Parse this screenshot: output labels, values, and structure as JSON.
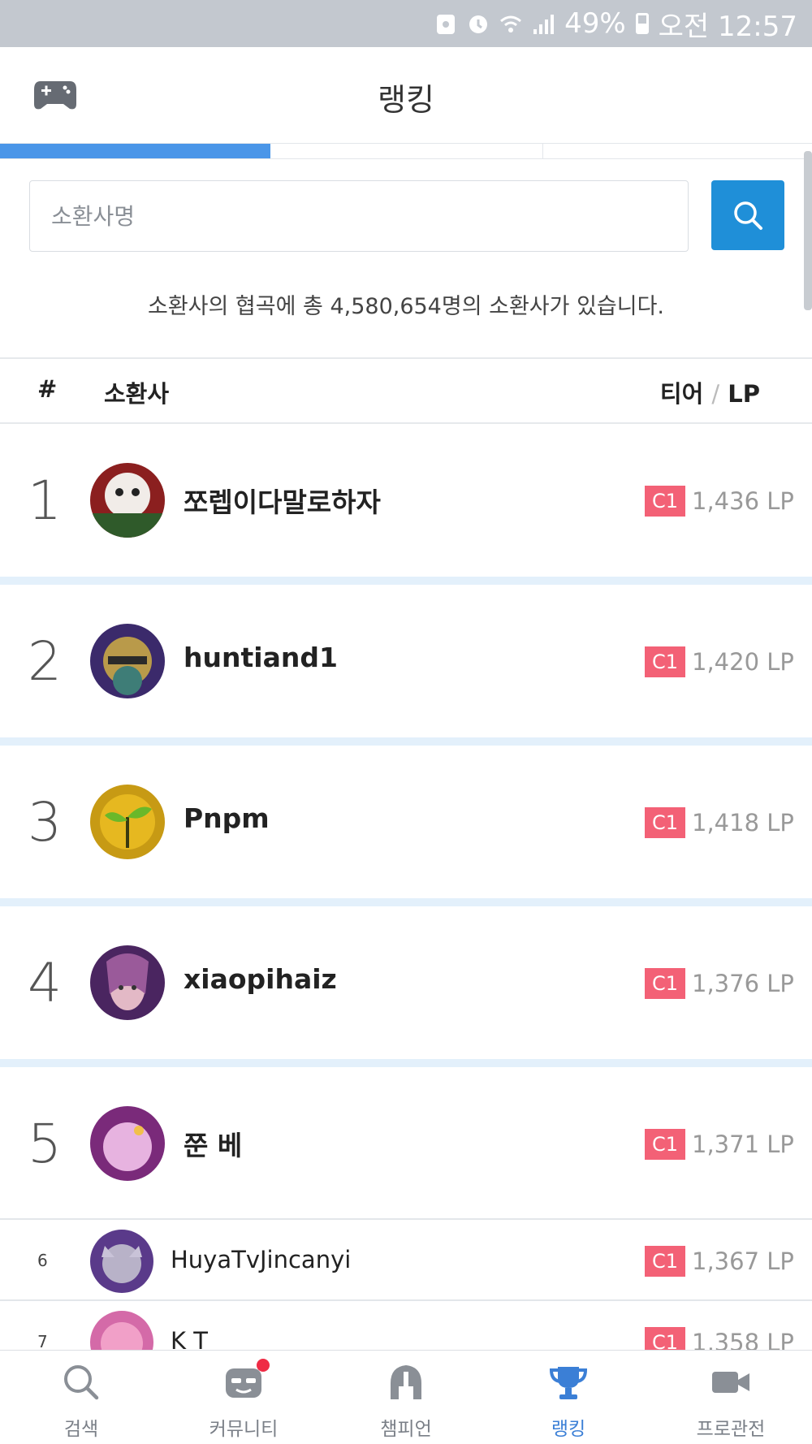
{
  "status_bar": {
    "battery": "49%",
    "time": "오전 12:57"
  },
  "header": {
    "title": "랭킹"
  },
  "search": {
    "placeholder": "소환사명"
  },
  "summary": "소환사의 협곡에 총 4,580,654명의 소환사가 있습니다.",
  "table": {
    "col_rank": "#",
    "col_summoner": "소환사",
    "col_tier": "티어",
    "col_sep": "/",
    "col_lp": "LP"
  },
  "rows": [
    {
      "rank": "1",
      "name": "쪼렙이다말로하자",
      "tier": "C1",
      "lp": "1,436 LP"
    },
    {
      "rank": "2",
      "name": "huntiand1",
      "tier": "C1",
      "lp": "1,420 LP"
    },
    {
      "rank": "3",
      "name": "Pnpm",
      "tier": "C1",
      "lp": "1,418 LP"
    },
    {
      "rank": "4",
      "name": "xiaopihaiz",
      "tier": "C1",
      "lp": "1,376 LP"
    },
    {
      "rank": "5",
      "name": "쭌 베",
      "tier": "C1",
      "lp": "1,371 LP"
    },
    {
      "rank": "6",
      "name": "HuyaTvJincanyi",
      "tier": "C1",
      "lp": "1,367 LP"
    },
    {
      "rank": "7",
      "name": "K T",
      "tier": "C1",
      "lp": "1,358 LP"
    }
  ],
  "nav": [
    {
      "label": "검색",
      "icon": "search-icon"
    },
    {
      "label": "커뮤니티",
      "icon": "community-icon"
    },
    {
      "label": "챔피언",
      "icon": "champion-helmet-icon"
    },
    {
      "label": "랭킹",
      "icon": "trophy-icon"
    },
    {
      "label": "프로관전",
      "icon": "video-camera-icon"
    }
  ],
  "colors": {
    "accent": "#1f8fd8",
    "active_tab": "#4a96e8",
    "tier_badge": "#f36176",
    "nav_active": "#3b7fd6"
  }
}
